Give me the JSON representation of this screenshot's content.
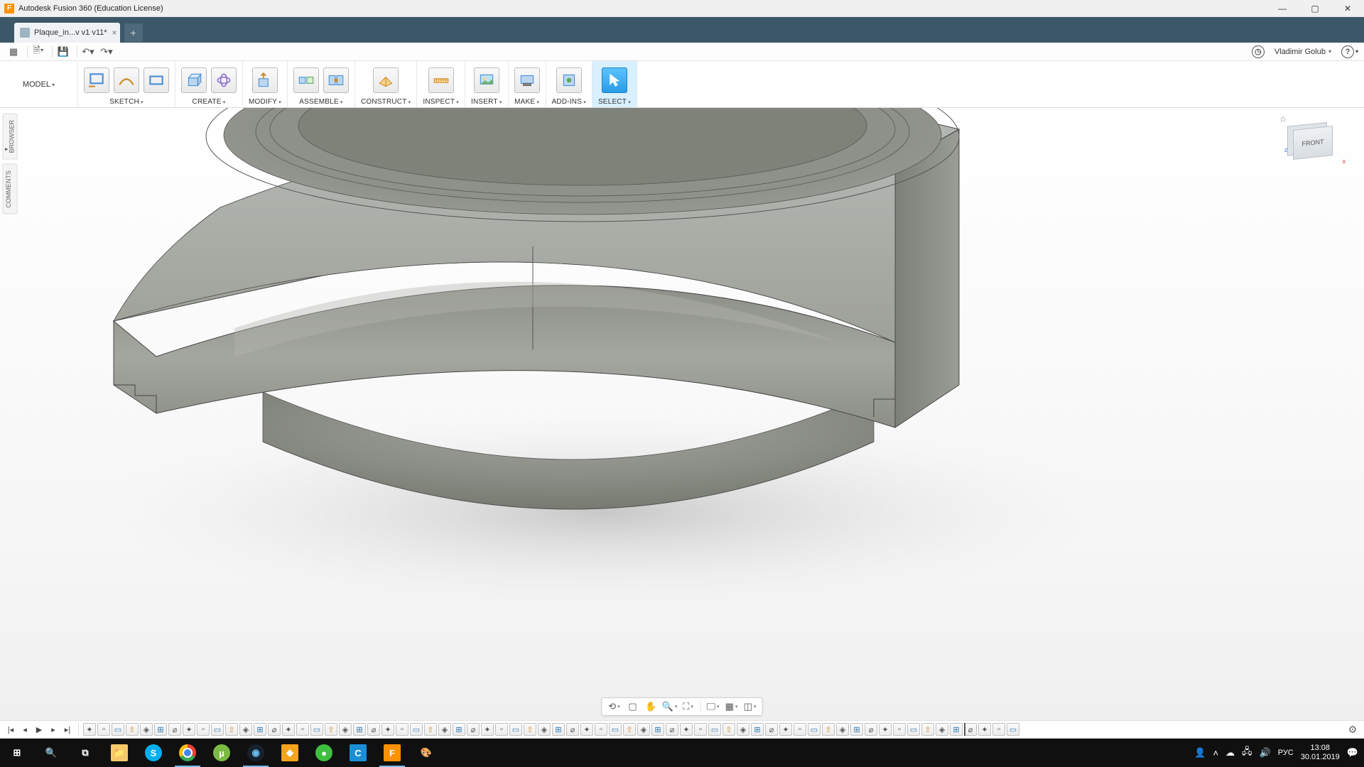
{
  "app": {
    "title": "Autodesk Fusion 360 (Education License)"
  },
  "tabs": {
    "document": "Plaque_in...v v1 v11*"
  },
  "qa": {
    "user": "Vladimir Golub"
  },
  "ribbon": {
    "workspace": "MODEL",
    "groups": {
      "sketch": "SKETCH",
      "create": "CREATE",
      "modify": "MODIFY",
      "assemble": "ASSEMBLE",
      "construct": "CONSTRUCT",
      "inspect": "INSPECT",
      "insert": "INSERT",
      "make": "MAKE",
      "addins": "ADD-INS",
      "select": "SELECT"
    }
  },
  "sidebar": {
    "browser": "BROWSER",
    "comments": "COMMENTS"
  },
  "viewcube": {
    "face": "FRONT",
    "axis_z": "z",
    "axis_x": "x"
  },
  "timeline": {
    "feature_count": 66,
    "marker_index": 62
  },
  "taskbar": {
    "lang": "РУС",
    "time": "13:08",
    "date": "30.01.2019"
  }
}
